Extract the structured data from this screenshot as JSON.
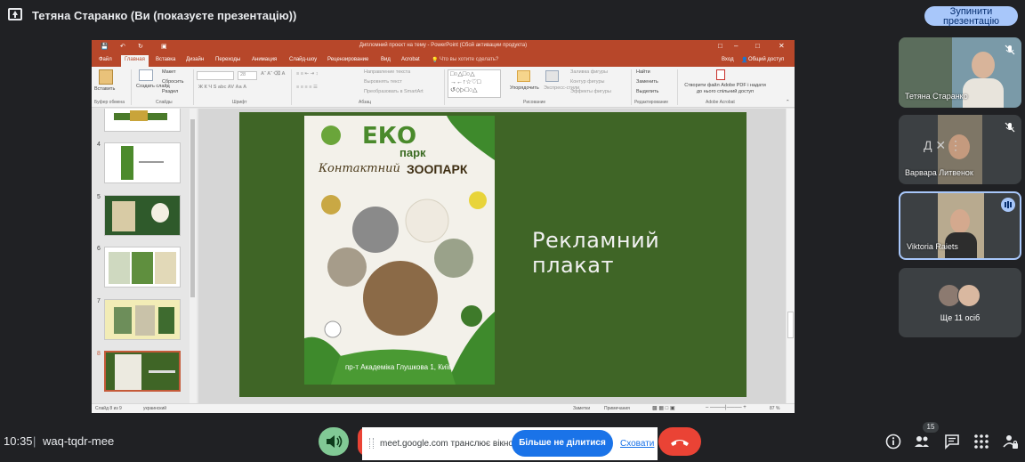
{
  "top_bar": {
    "title": "Тетяна Старанко (Ви (показуєте презентацію))",
    "stop_button": "Зупинити презентацію"
  },
  "powerpoint": {
    "window_title": "Дипломний проєкт на тему - PowerPoint (Сбой активации продукта)",
    "tabs": [
      "Файл",
      "Главная",
      "Вставка",
      "Дизайн",
      "Переходы",
      "Анимация",
      "Слайд-шоу",
      "Рецензирование",
      "Вид",
      "Acrobat"
    ],
    "tell_me": "Что вы хотите сделать?",
    "sign_in": "Вход",
    "share": "Общий доступ",
    "ribbon": {
      "paste": "Вставить",
      "create_slide": "Создать слайд",
      "layout": "Макет",
      "reset": "Сбросить",
      "section": "Раздел",
      "clipboard_group": "Буфер обмена",
      "slides_group": "Слайды",
      "font_group": "Шрифт",
      "paragraph_group": "Абзац",
      "drawing_group": "Рисование",
      "editing_group": "Редактирование",
      "acrobat_group": "Adobe Acrobat",
      "text_direction": "Направление текста",
      "align_text": "Выровнять текст",
      "smartart": "Преобразовать в SmartArt",
      "arrange": "Упорядочить",
      "quick_styles": "Экспресс-стили",
      "shape_fill": "Заливка фигуры",
      "shape_outline": "Контур фигуры",
      "shape_effects": "Эффекты фигуры",
      "find": "Найти",
      "replace": "Заменить",
      "select": "Выделить",
      "adobe_pdf": "Створити файл Adobe PDF і надати до нього спільний доступ",
      "font_size": "28"
    },
    "thumbnails": [
      {
        "num": "4"
      },
      {
        "num": "5"
      },
      {
        "num": "6"
      },
      {
        "num": "7"
      },
      {
        "num": "8"
      }
    ],
    "slide": {
      "heading": "Рекламний плакат",
      "poster_logo_eko": "ЕКО",
      "poster_logo_park": "парк",
      "poster_subtitle_1": "Контактний",
      "poster_subtitle_2": "ЗООПАРК",
      "poster_address": "пр-т Академіка Глушкова 1, Київ."
    },
    "status": {
      "slide_of": "Слайд 8 из 9",
      "language": "украинский",
      "notes": "Заметки",
      "comments": "Примечания",
      "zoom": "87 %"
    }
  },
  "participants": [
    {
      "name": "Тетяна Старанко"
    },
    {
      "name": "Варвара Литвенок"
    },
    {
      "name": "Viktoria Raiets"
    }
  ],
  "more_participants": "Ще 11 осіб",
  "bottom": {
    "time": "10:35",
    "divider": "|",
    "meeting_code": "waq-tqdr-mee",
    "people_count": "15"
  },
  "share_banner": {
    "message": "meet.google.com транслює вікно.",
    "stop_sharing": "Більше не ділитися",
    "hide": "Сховати"
  },
  "colors": {
    "ppt_accent": "#b7472a",
    "slide_bg": "#3f6526",
    "meet_bg": "#202124",
    "stop_button": "#a8c7fa",
    "end_call": "#ea4335",
    "mic_active": "#81c995"
  }
}
